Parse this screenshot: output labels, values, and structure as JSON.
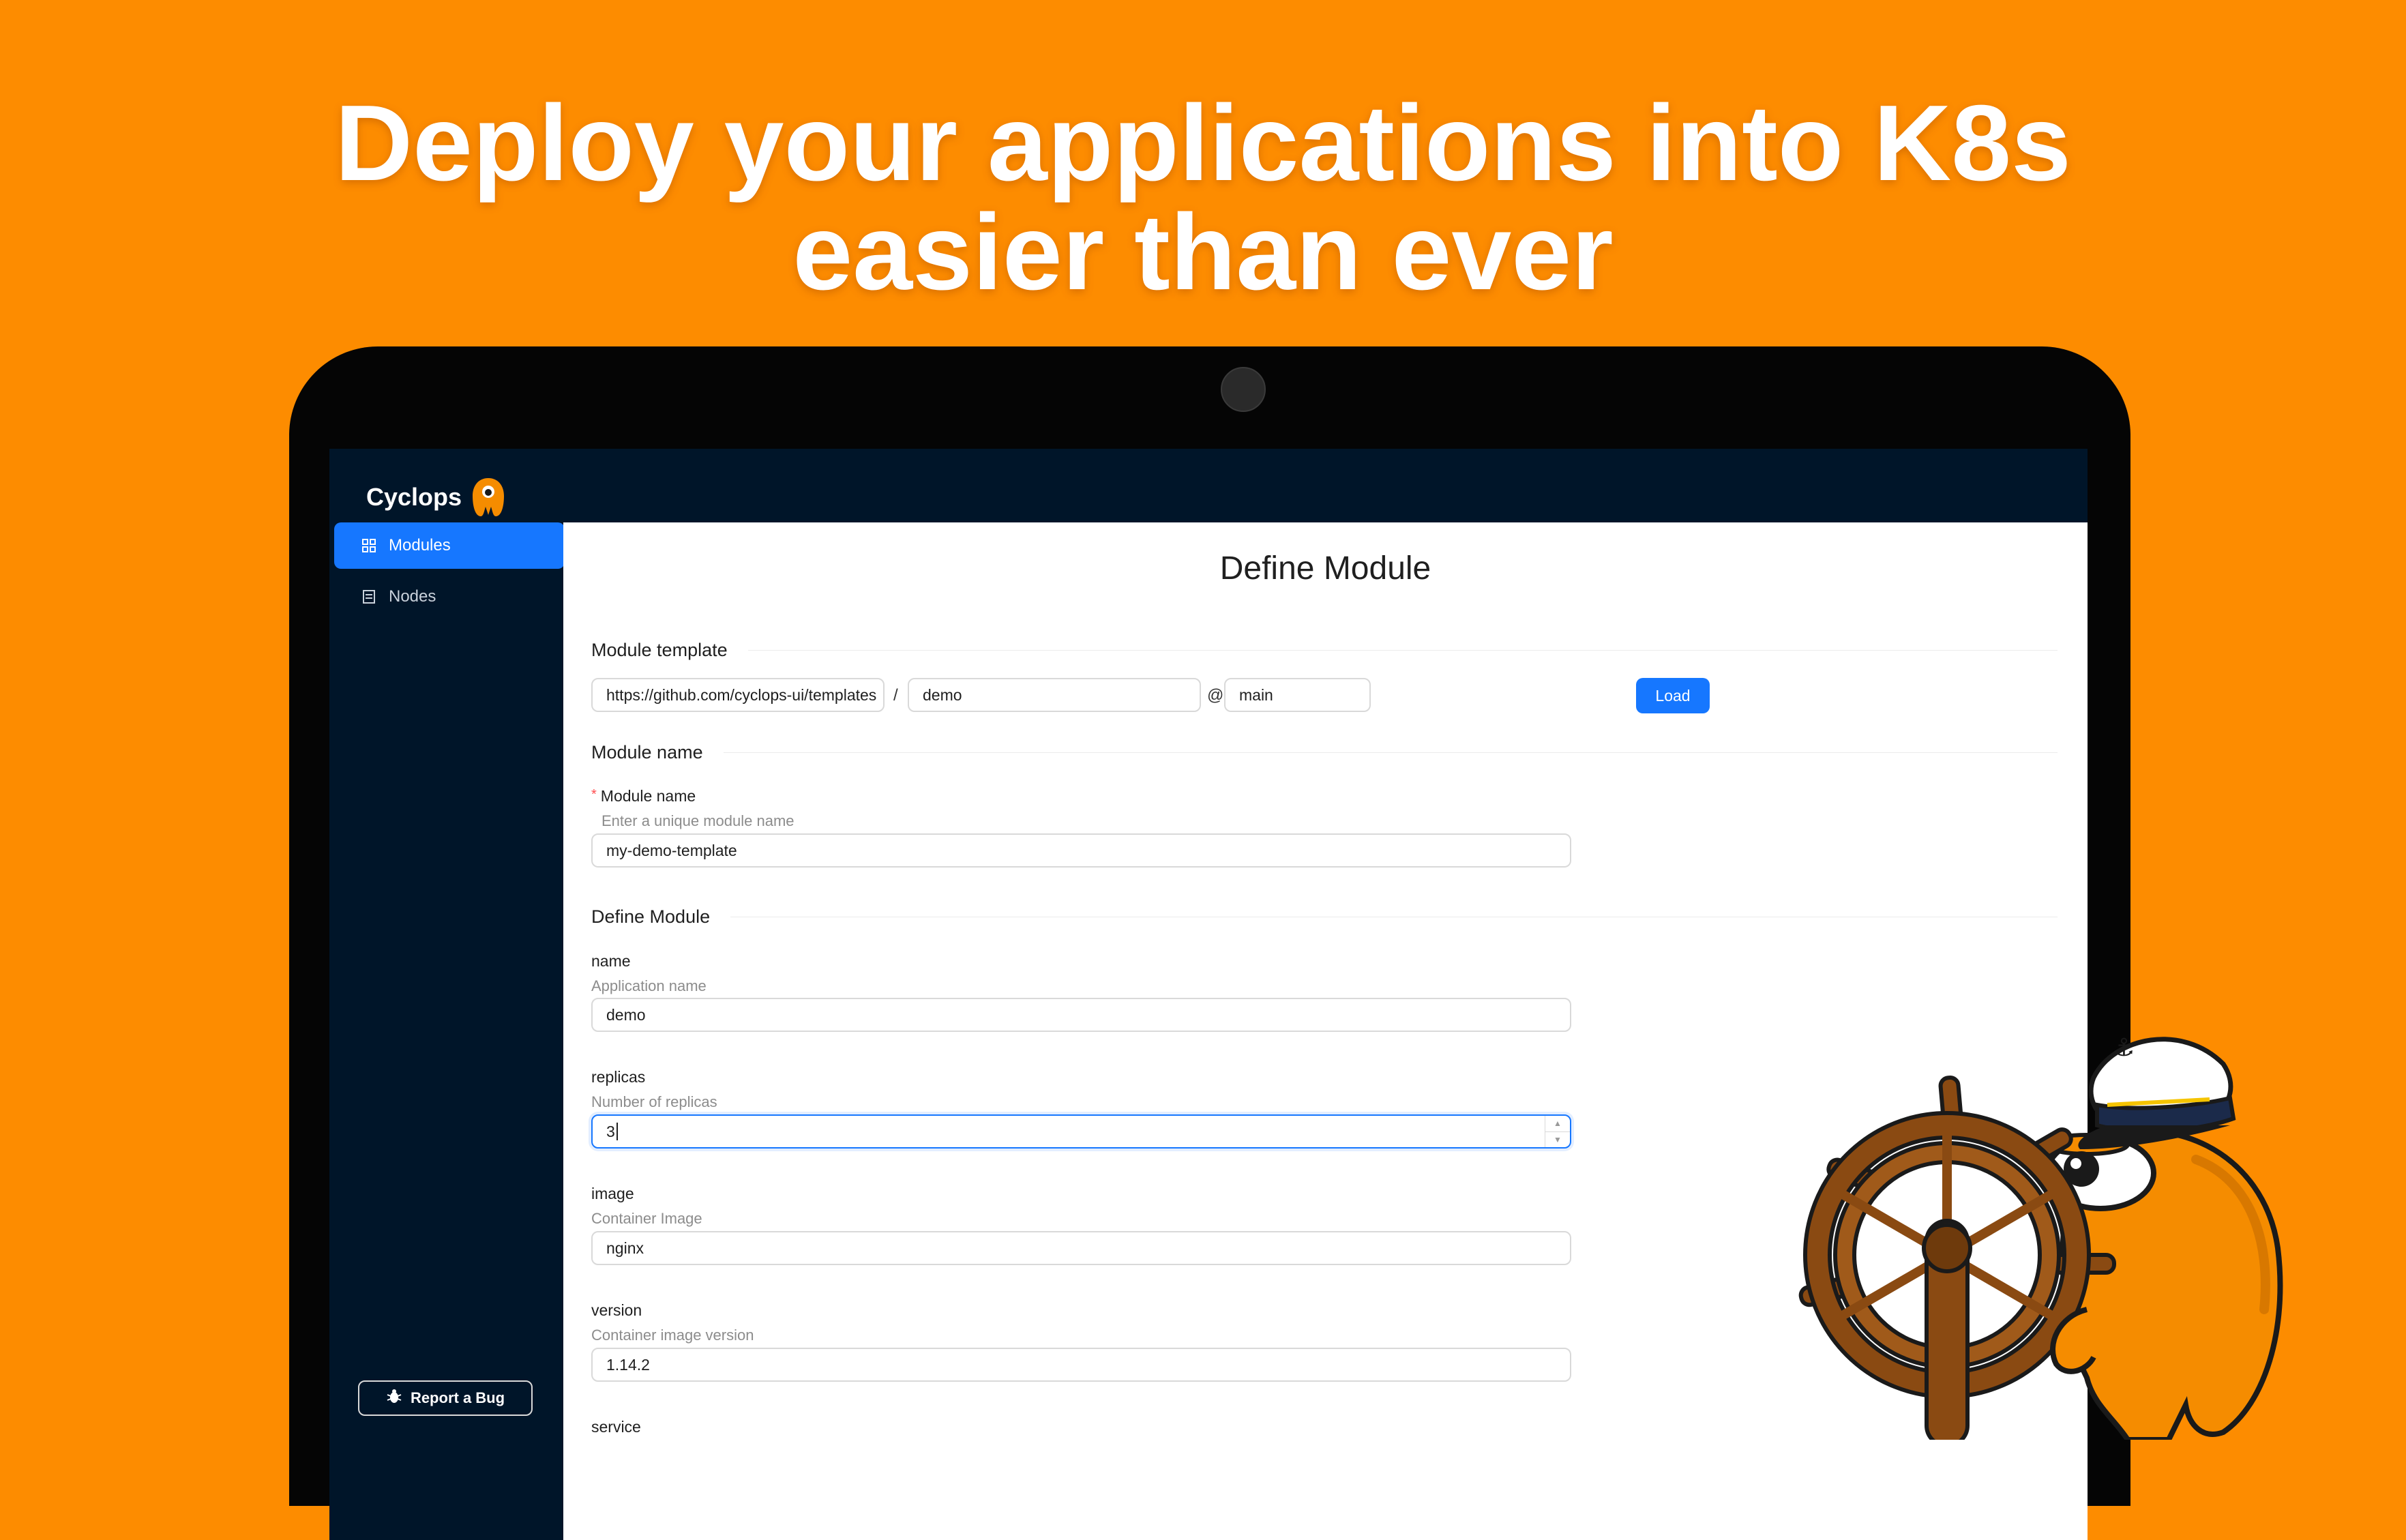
{
  "hero": {
    "line1": "Deploy your applications into K8s",
    "line2": "easier than ever"
  },
  "app": {
    "brand": "Cyclops"
  },
  "sidebar": {
    "items": [
      {
        "label": "Modules",
        "icon": "modules-icon",
        "active": true
      },
      {
        "label": "Nodes",
        "icon": "nodes-icon",
        "active": false
      }
    ],
    "report_bug": "Report a Bug"
  },
  "form": {
    "title": "Define Module",
    "template_section": "Module template",
    "repo_url": "https://github.com/cyclops-ui/templates",
    "path_sep": "/",
    "path": "demo",
    "version_sep": "@",
    "version": "main",
    "load_label": "Load",
    "name_section": "Module name",
    "module_name_label": "Module name",
    "module_name_help": "Enter a unique module name",
    "module_name_value": "my-demo-template",
    "define_section": "Define Module",
    "fields": [
      {
        "label": "name",
        "help": "Application name",
        "value": "demo"
      },
      {
        "label": "replicas",
        "help": "Number of replicas",
        "value": "3"
      },
      {
        "label": "image",
        "help": "Container Image",
        "value": "nginx"
      },
      {
        "label": "version",
        "help": "Container image version",
        "value": "1.14.2"
      },
      {
        "label": "service"
      }
    ]
  },
  "colors": {
    "background": "#fd8c00",
    "sidebar": "#001529",
    "primary": "#1677ff"
  }
}
